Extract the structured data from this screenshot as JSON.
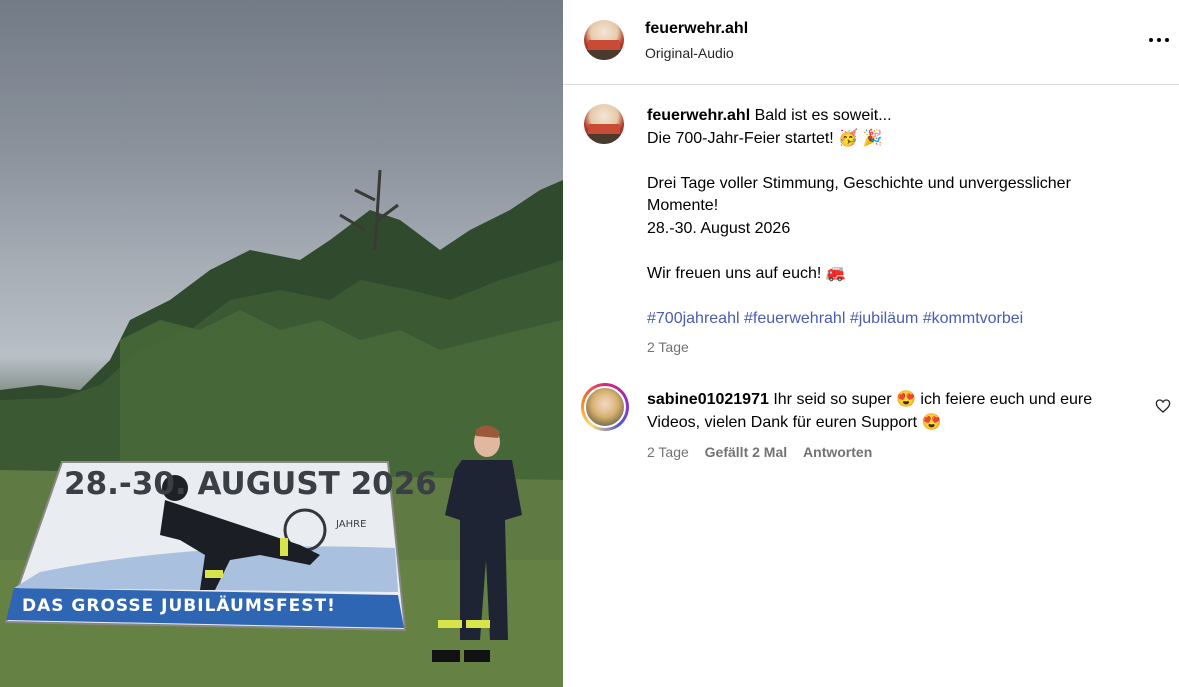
{
  "post": {
    "username": "feuerwehr.ahl",
    "audio": "Original-Audio",
    "caption_lines": [
      "Bald ist es soweit...",
      "Die 700-Jahr-Feier startet! 🥳 🎉",
      "",
      "Drei Tage voller Stimmung, Geschichte und unvergesslicher",
      "Momente!",
      "28.-30. August 2026",
      "",
      "Wir freuen uns auf euch! 🚒",
      ""
    ],
    "hashtags": "#700jahreahl #feuerwehrahl #jubiläum #kommtvorbei",
    "time": "2 Tage"
  },
  "media": {
    "banner_top": "28.-30. AUGUST 2026",
    "banner_bottom": "DAS GROSSE JUBILÄUMSFEST!",
    "banner_jahre": "JAHRE"
  },
  "comment": {
    "username": "sabine01021971",
    "text_line1": "Ihr seid so super 😍  ich feiere euch und eure",
    "text_line2": "Videos, vielen Dank für euren Support 😍",
    "time": "2 Tage",
    "likes": "Gefällt 2 Mal",
    "reply": "Antworten"
  },
  "icons": {
    "more": "more-options-icon",
    "heart": "heart-icon"
  }
}
